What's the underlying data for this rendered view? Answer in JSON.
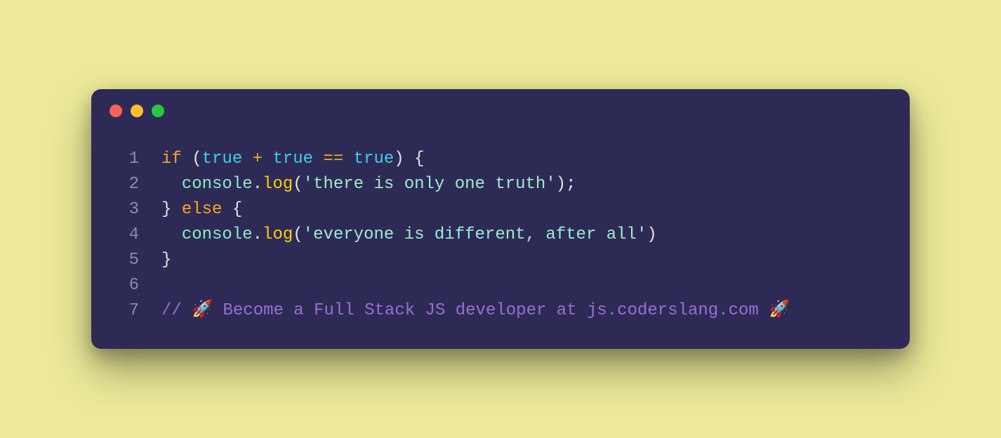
{
  "colors": {
    "page_bg": "#ecea99",
    "window_bg": "#2d2b55",
    "gutter": "#8d89b0",
    "keyword": "#f5a623",
    "bool": "#3fcde6",
    "operator": "#f5a623",
    "punct": "#e3e3e3",
    "ident": "#8fe9c9",
    "method": "#fad000",
    "string": "#a0ead0",
    "comment": "#9b6dd7",
    "dot_red": "#ff5f56",
    "dot_yellow": "#ffbd2e",
    "dot_green": "#27c93f"
  },
  "traffic_lights": [
    "close",
    "minimize",
    "maximize"
  ],
  "code": {
    "raw": "if (true + true == true) {\n  console.log('there is only one truth');\n} else {\n  console.log('everyone is different, after all')\n}\n\n// 🚀 Become a Full Stack JS developer at js.coderslang.com 🚀",
    "lines": [
      {
        "n": "1",
        "tokens": [
          {
            "t": "if",
            "c": "keyword"
          },
          {
            "t": " (",
            "c": "punct"
          },
          {
            "t": "true",
            "c": "bool"
          },
          {
            "t": " + ",
            "c": "operator"
          },
          {
            "t": "true",
            "c": "bool"
          },
          {
            "t": " == ",
            "c": "operator"
          },
          {
            "t": "true",
            "c": "bool"
          },
          {
            "t": ") {",
            "c": "punct"
          }
        ]
      },
      {
        "n": "2",
        "tokens": [
          {
            "t": "  ",
            "c": "punct"
          },
          {
            "t": "console",
            "c": "ident"
          },
          {
            "t": ".",
            "c": "punct"
          },
          {
            "t": "log",
            "c": "method"
          },
          {
            "t": "(",
            "c": "punct"
          },
          {
            "t": "'there is only one truth'",
            "c": "string"
          },
          {
            "t": ");",
            "c": "punct"
          }
        ]
      },
      {
        "n": "3",
        "tokens": [
          {
            "t": "} ",
            "c": "punct"
          },
          {
            "t": "else",
            "c": "keyword"
          },
          {
            "t": " {",
            "c": "punct"
          }
        ]
      },
      {
        "n": "4",
        "tokens": [
          {
            "t": "  ",
            "c": "punct"
          },
          {
            "t": "console",
            "c": "ident"
          },
          {
            "t": ".",
            "c": "punct"
          },
          {
            "t": "log",
            "c": "method"
          },
          {
            "t": "(",
            "c": "punct"
          },
          {
            "t": "'everyone is different, after all'",
            "c": "string"
          },
          {
            "t": ")",
            "c": "punct"
          }
        ]
      },
      {
        "n": "5",
        "tokens": [
          {
            "t": "}",
            "c": "punct"
          }
        ]
      },
      {
        "n": "6",
        "tokens": []
      },
      {
        "n": "7",
        "tokens": [
          {
            "t": "// 🚀 Become a Full Stack JS developer at js.coderslang.com 🚀",
            "c": "comment"
          }
        ]
      }
    ]
  }
}
